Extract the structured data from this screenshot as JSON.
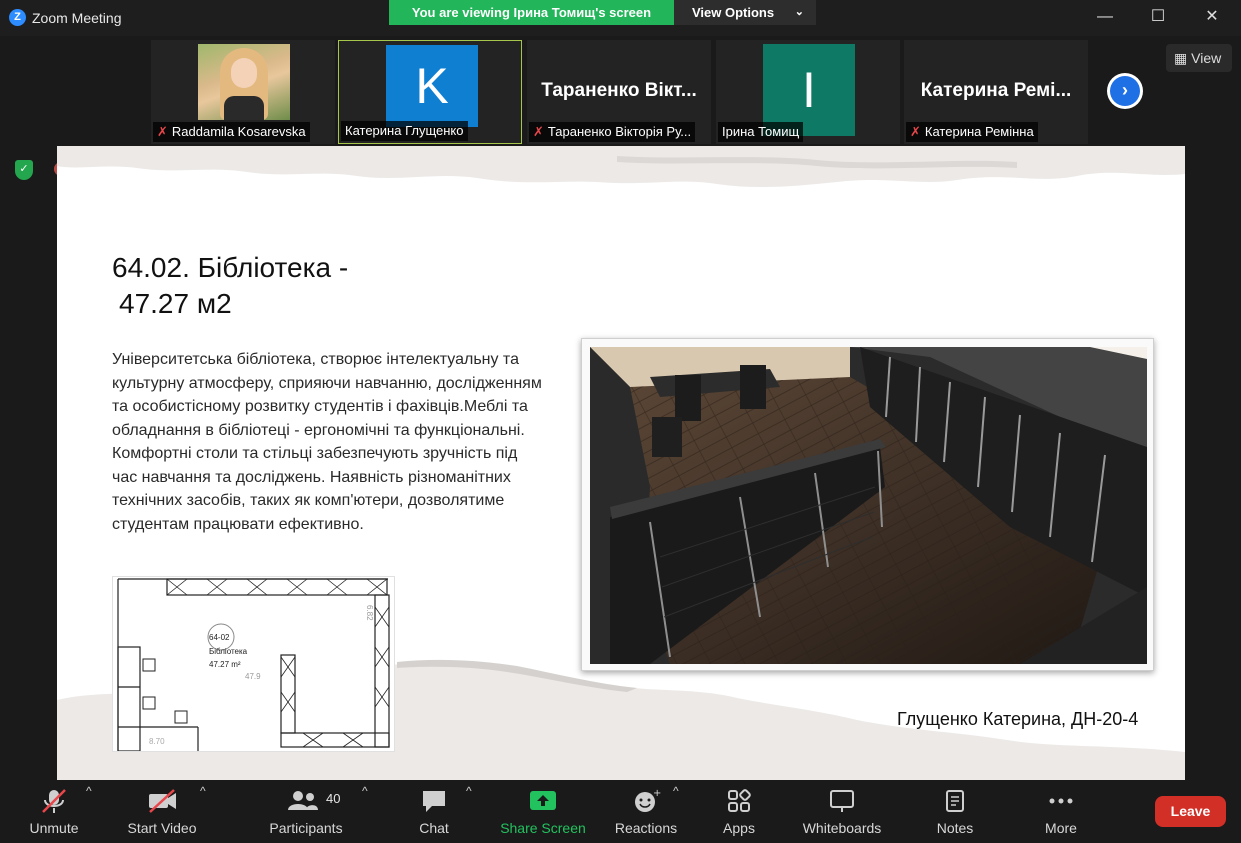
{
  "window": {
    "title": "Zoom Meeting",
    "logo_letter": "Z",
    "minimize": "—",
    "maximize": "☐",
    "close": "✕"
  },
  "banner": {
    "viewing_text": "You are viewing Ірина Томищ's screen",
    "view_options_label": "View Options",
    "view_options_chevron": "⌄"
  },
  "thumbnails": [
    {
      "label": "Raddamila Kosarevska",
      "muted": true,
      "type": "photo"
    },
    {
      "label": "Катерина Глущенко",
      "muted": false,
      "type": "avatar",
      "initial": "K",
      "color": "#0e7fd1"
    },
    {
      "label": "Тараненко Вікторія Ру...",
      "muted": true,
      "type": "name",
      "big_name": "Тараненко Вікт..."
    },
    {
      "label": "Ірина Томищ",
      "muted": false,
      "type": "avatar",
      "initial": "I",
      "color": "#0e7a66"
    },
    {
      "label": "Катерина Ремінна",
      "muted": true,
      "type": "name",
      "big_name": "Катерина Ремі..."
    }
  ],
  "strip": {
    "view_label": "View",
    "next_arrow": "›",
    "mute_glyph": "✗"
  },
  "slide": {
    "title_line1": "64.02. Бібліотека  -",
    "title_line2": "47.27 м2",
    "body": "Університетська бібліотека, створює інтелектуальну та культурну атмосферу, сприяючи навчанню, дослідженням та особистісному розвитку студентів і фахівців.Меблі та обладнання в бібліотеці - ергономічні та функціональні. Комфортні столи та стільці забезпечують зручність під час навчання та досліджень. Наявність різноманітних технічних засобів, таких як комп'ютери, дозволятиме студентам  працювати ефективно.",
    "plan_room_number": "64-02",
    "plan_room_name": "Бібліотека",
    "plan_area": "47.27 m²",
    "plan_small_num": "47.9",
    "plan_dim_right": "6.82",
    "plan_dim_bottom": "8.70",
    "author": "Глущенко Катерина, ДН-20-4"
  },
  "toolbar": {
    "unmute": "Unmute",
    "start_video": "Start Video",
    "participants": "Participants",
    "participants_count": "40",
    "chat": "Chat",
    "share_screen": "Share Screen",
    "reactions": "Reactions",
    "apps": "Apps",
    "whiteboards": "Whiteboards",
    "notes": "Notes",
    "more": "More",
    "leave": "Leave",
    "caret": "^"
  },
  "colors": {
    "share_green": "#22c25e",
    "banner_green": "#23b55a",
    "leave_red": "#d22f27",
    "mute_red": "#e8464a",
    "accent_blue": "#1f6fe5"
  }
}
